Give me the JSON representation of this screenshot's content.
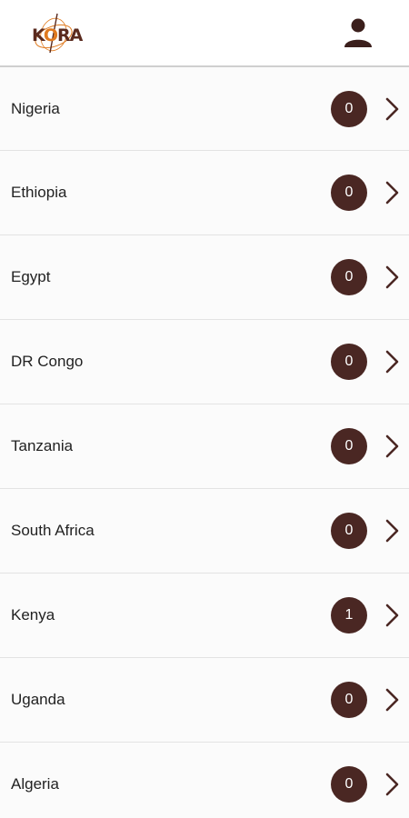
{
  "header": {
    "logo_text_main": "K",
    "logo_text_accent": "RA",
    "logo_text_mid": "O"
  },
  "countries": [
    {
      "name": "Nigeria",
      "count": "0"
    },
    {
      "name": "Ethiopia",
      "count": "0"
    },
    {
      "name": "Egypt",
      "count": "0"
    },
    {
      "name": "DR Congo",
      "count": "0"
    },
    {
      "name": "Tanzania",
      "count": "0"
    },
    {
      "name": "South Africa",
      "count": "0"
    },
    {
      "name": "Kenya",
      "count": "1"
    },
    {
      "name": "Uganda",
      "count": "0"
    },
    {
      "name": "Algeria",
      "count": "0"
    }
  ],
  "colors": {
    "badge_bg": "#4a2723",
    "chevron": "#4a2723",
    "logo_brown": "#5a2a1e",
    "logo_orange": "#e07a1f"
  }
}
